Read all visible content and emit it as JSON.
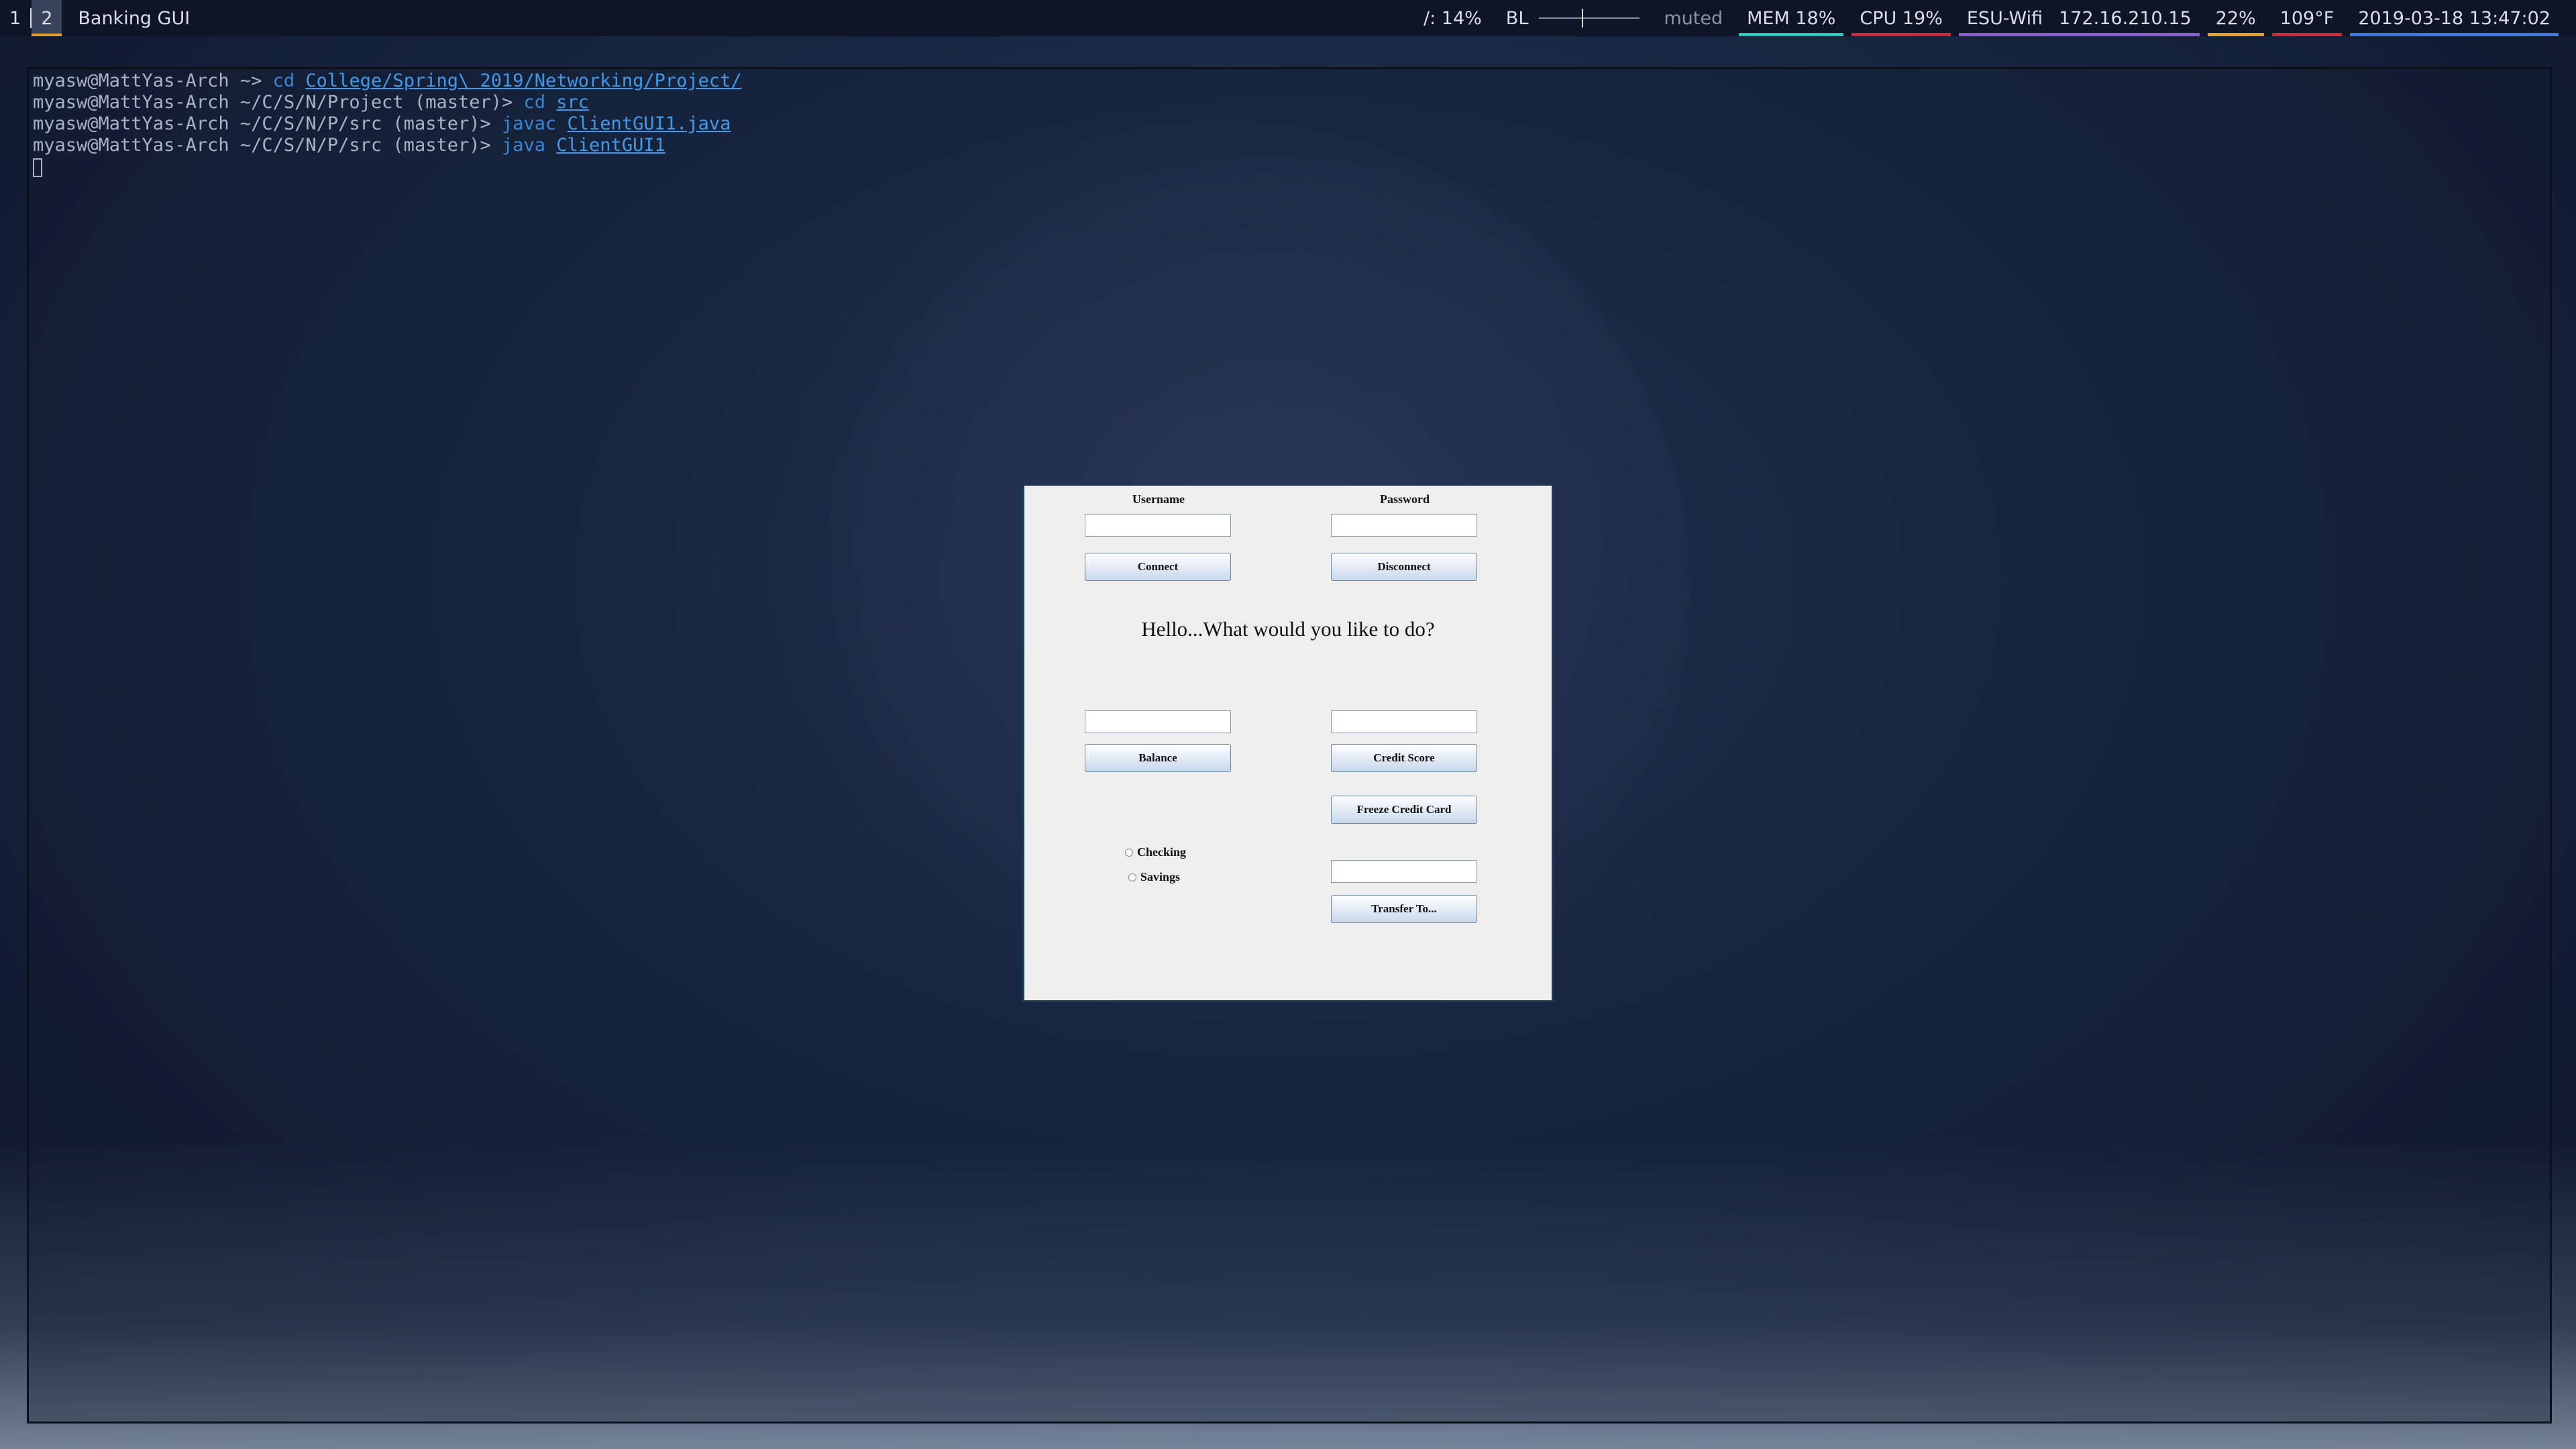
{
  "topbar": {
    "workspaces": [
      "1",
      "2"
    ],
    "active_workspace": "2",
    "window_title": "Banking GUI",
    "status": {
      "disk": "/: 14%",
      "backlight_label": "BL",
      "volume": "muted",
      "mem": "MEM 18%",
      "cpu": "CPU 19%",
      "wifi_name": "ESU-Wifi",
      "ip": "172.16.210.15",
      "battery": "22%",
      "temp": "109°F",
      "datetime": "2019-03-18 13:47:02"
    },
    "colors": {
      "mem": "#2ec4b6",
      "cpu": "#d0263a",
      "wifi": "#8a5cd0",
      "battery": "#e0a030",
      "temp": "#d0263a",
      "datetime": "#3b7be0"
    }
  },
  "terminal": {
    "lines": [
      {
        "prompt": "myasw@MattYas-Arch ~> ",
        "cmd": "cd",
        "arg": "College/Spring\\ 2019/Networking/Project/"
      },
      {
        "prompt": "myasw@MattYas-Arch ~/C/S/N/Project (master)> ",
        "cmd": "cd",
        "arg": "src"
      },
      {
        "prompt": "myasw@MattYas-Arch ~/C/S/N/P/src (master)> ",
        "cmd": "javac",
        "arg": "ClientGUI1.java"
      },
      {
        "prompt": "myasw@MattYas-Arch ~/C/S/N/P/src (master)> ",
        "cmd": "java",
        "arg": "ClientGUI1"
      }
    ]
  },
  "banking": {
    "username_label": "Username",
    "password_label": "Password",
    "username_value": "",
    "password_value": "",
    "connect_label": "Connect",
    "disconnect_label": "Disconnect",
    "greeting": "Hello...What would you like to do?",
    "balance_field_value": "",
    "credit_field_value": "",
    "balance_label": "Balance",
    "credit_score_label": "Credit Score",
    "freeze_label": "Freeze Credit Card",
    "checking_label": "Checking",
    "savings_label": "Savings",
    "transfer_field_value": "",
    "transfer_label": "Transfer To..."
  }
}
